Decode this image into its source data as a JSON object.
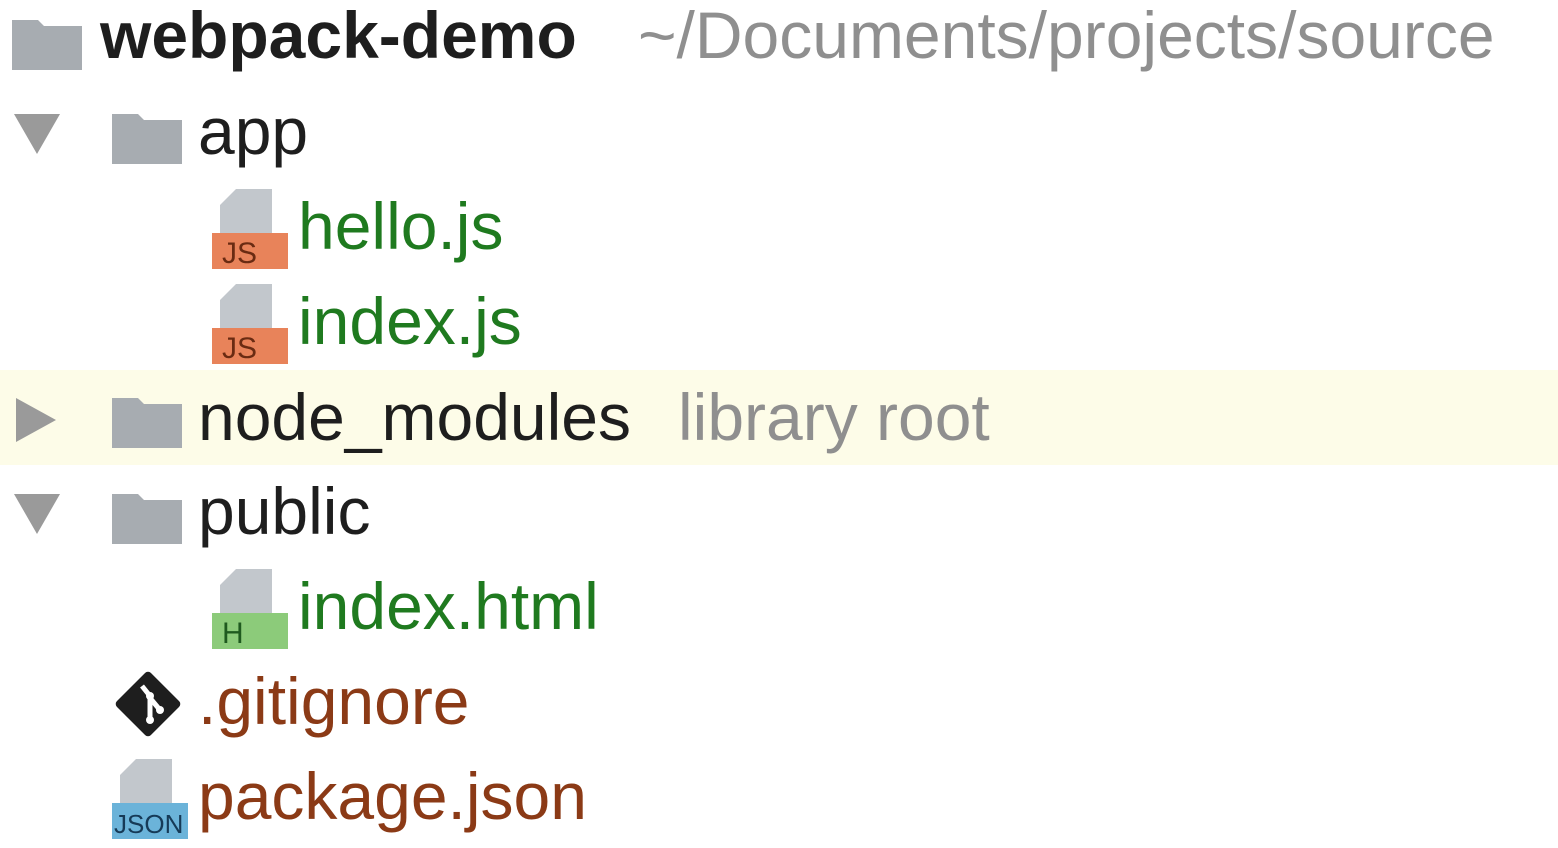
{
  "project": {
    "name": "webpack-demo",
    "path": "~/Documents/projects/source"
  },
  "tree": {
    "app": {
      "label": "app",
      "expanded": true,
      "files": [
        {
          "label": "hello.js",
          "badge": "JS"
        },
        {
          "label": "index.js",
          "badge": "JS"
        }
      ]
    },
    "node_modules": {
      "label": "node_modules",
      "hint": "library root",
      "expanded": false
    },
    "public": {
      "label": "public",
      "expanded": true,
      "files": [
        {
          "label": "index.html",
          "badge": "H"
        }
      ]
    },
    "gitignore": {
      "label": ".gitignore"
    },
    "package_json": {
      "label": "package.json",
      "badge": "JSON"
    }
  },
  "colors": {
    "highlight_row": "#fdfce8",
    "js_badge": "#e8835a",
    "html_badge": "#8ccb7a",
    "json_badge": "#6bb3d9",
    "vcs_green_text": "#1f7a1f",
    "vcs_brown_text": "#8b3a16",
    "folder_grey": "#a7acb1"
  },
  "icons": {
    "expanded": "triangle-down-icon",
    "collapsed": "triangle-right-icon",
    "folder": "folder-icon",
    "js_file": "js-file-icon",
    "html_file": "html-file-icon",
    "json_file": "json-file-icon",
    "git": "git-icon"
  }
}
